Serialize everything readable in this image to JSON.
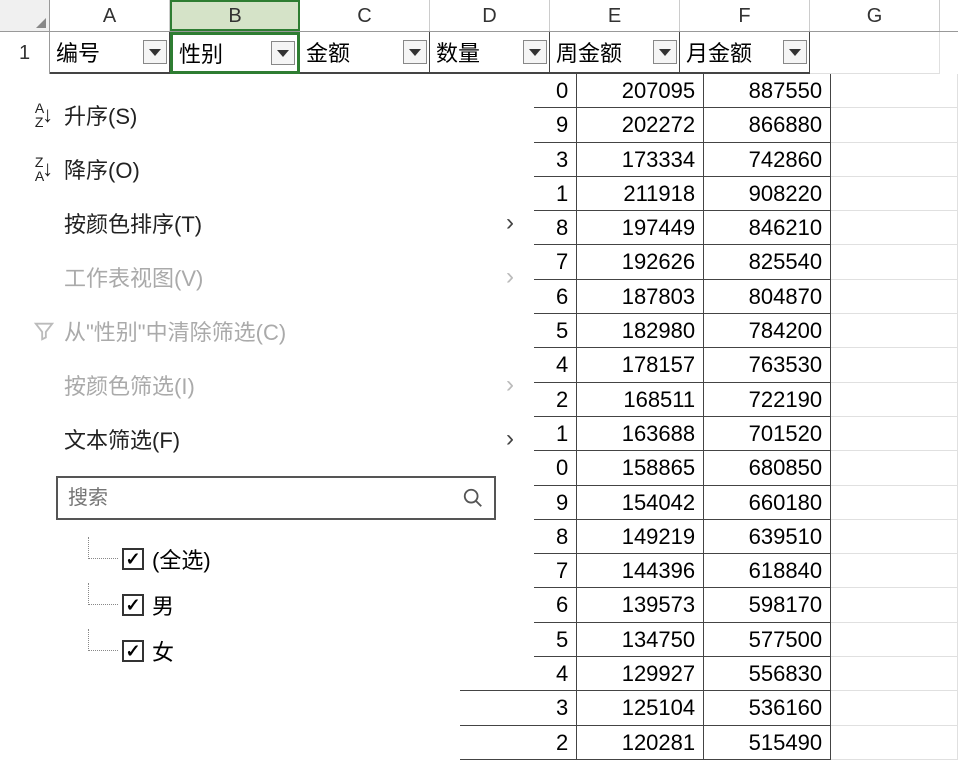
{
  "column_letters": [
    "A",
    "B",
    "C",
    "D",
    "E",
    "F",
    "G"
  ],
  "row1_label": "1",
  "headers": {
    "A": "编号",
    "B": "性别",
    "C": "金额",
    "D": "数量",
    "E": "周金额",
    "F": "月金额"
  },
  "selected_column": "B",
  "menu": {
    "sort_asc": "升序(S)",
    "sort_desc": "降序(O)",
    "sort_by_color": "按颜色排序(T)",
    "sheet_view": "工作表视图(V)",
    "clear_filter": "从\"性别\"中清除筛选(C)",
    "filter_by_color": "按颜色筛选(I)",
    "text_filter": "文本筛选(F)",
    "search_placeholder": "搜索"
  },
  "filter_values": [
    {
      "label": "(全选)",
      "checked": true
    },
    {
      "label": "男",
      "checked": true
    },
    {
      "label": "女",
      "checked": true
    }
  ],
  "data_rows": [
    {
      "D": "0",
      "E": "207095",
      "F": "887550"
    },
    {
      "D": "9",
      "E": "202272",
      "F": "866880"
    },
    {
      "D": "3",
      "E": "173334",
      "F": "742860"
    },
    {
      "D": "1",
      "E": "211918",
      "F": "908220"
    },
    {
      "D": "8",
      "E": "197449",
      "F": "846210"
    },
    {
      "D": "7",
      "E": "192626",
      "F": "825540"
    },
    {
      "D": "6",
      "E": "187803",
      "F": "804870"
    },
    {
      "D": "5",
      "E": "182980",
      "F": "784200"
    },
    {
      "D": "4",
      "E": "178157",
      "F": "763530"
    },
    {
      "D": "2",
      "E": "168511",
      "F": "722190"
    },
    {
      "D": "1",
      "E": "163688",
      "F": "701520"
    },
    {
      "D": "0",
      "E": "158865",
      "F": "680850"
    },
    {
      "D": "9",
      "E": "154042",
      "F": "660180"
    },
    {
      "D": "8",
      "E": "149219",
      "F": "639510"
    },
    {
      "D": "7",
      "E": "144396",
      "F": "618840"
    },
    {
      "D": "6",
      "E": "139573",
      "F": "598170"
    },
    {
      "D": "5",
      "E": "134750",
      "F": "577500"
    },
    {
      "D": "4",
      "E": "129927",
      "F": "556830"
    },
    {
      "D": "3",
      "E": "125104",
      "F": "536160"
    },
    {
      "D": "2",
      "E": "120281",
      "F": "515490"
    }
  ]
}
